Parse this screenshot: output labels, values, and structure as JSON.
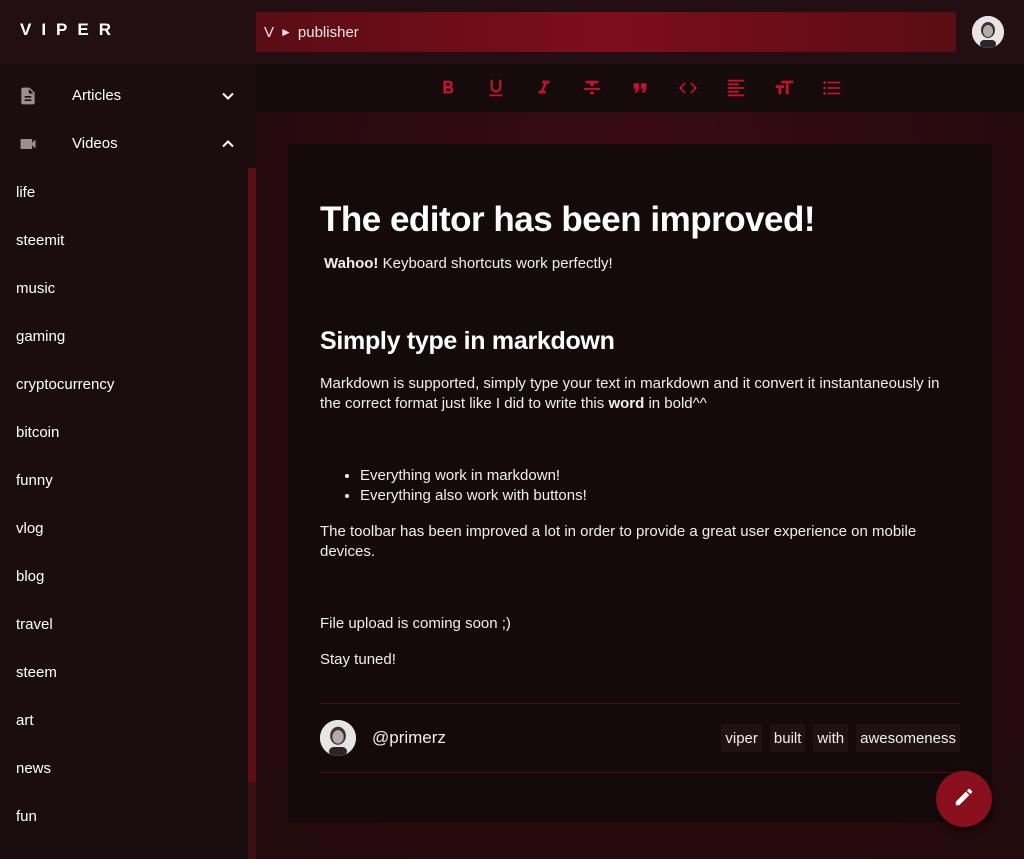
{
  "app": {
    "logo": "VIPER"
  },
  "breadcrumb": {
    "root": "V",
    "separator": "►",
    "current": "publisher"
  },
  "sidebar": {
    "sections": [
      {
        "label": "Articles",
        "icon": "document-icon",
        "expanded": false
      },
      {
        "label": "Videos",
        "icon": "videocam-icon",
        "expanded": true
      }
    ],
    "tags": [
      "life",
      "steemit",
      "music",
      "gaming",
      "cryptocurrency",
      "bitcoin",
      "funny",
      "vlog",
      "blog",
      "travel",
      "steem",
      "art",
      "news",
      "fun"
    ]
  },
  "toolbar": {
    "buttons": [
      "bold-icon",
      "underline-icon",
      "italic-icon",
      "strikethrough-icon",
      "quote-icon",
      "code-icon",
      "align-left-icon",
      "text-size-icon",
      "bullet-list-icon"
    ],
    "icon_color": "#c2132b"
  },
  "article": {
    "title": "The editor has been improved!",
    "intro_bold": "Wahoo!",
    "intro_text": " Keyboard shortcuts work perfectly!",
    "h2": "Simply type in markdown",
    "para1_before": "Markdown is supported, simply type your text in markdown and it convert it instantaneously in the correct format just like I did to write this ",
    "para1_bold": "word",
    "para1_after": " in bold^^",
    "bullets": [
      "Everything work in markdown!",
      "Everything also work with buttons!"
    ],
    "para2": "The toolbar has been improved a lot in order to provide a great user experience on mobile devices.",
    "para3": "File upload is coming soon ;)",
    "para4": "Stay tuned!"
  },
  "author": {
    "handle": "@primerz"
  },
  "tags": [
    "viper",
    "built",
    "with",
    "awesomeness"
  ],
  "colors": {
    "accent": "#c2132b",
    "fab": "#8a0f1c",
    "background": "#1a0b0e"
  }
}
